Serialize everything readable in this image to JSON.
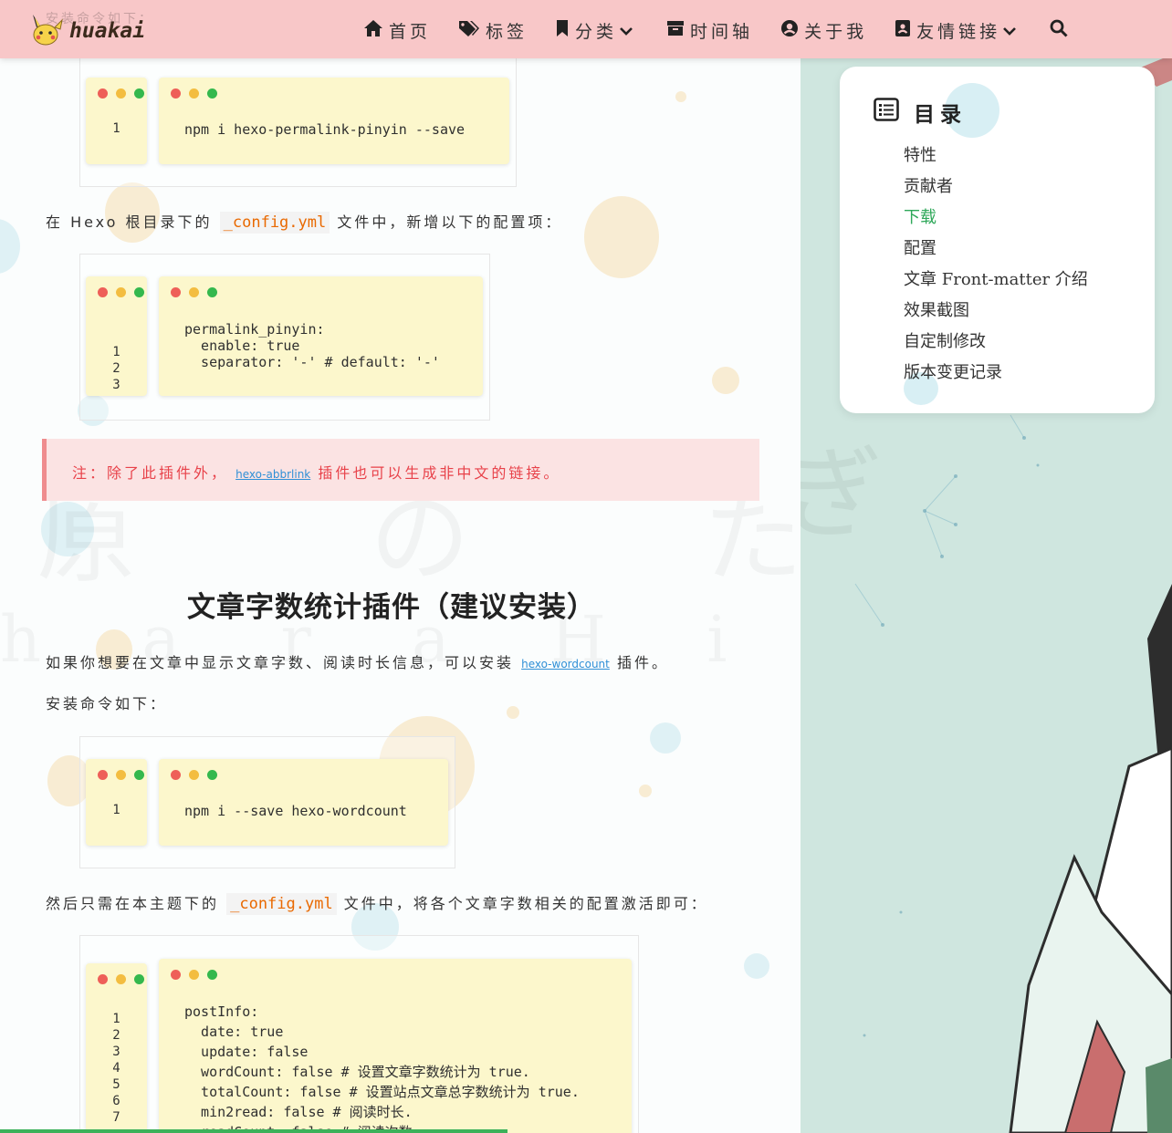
{
  "navbar": {
    "brand": "huakai",
    "ghost_text": "安装命令如下：",
    "items": [
      {
        "label": "首页",
        "icon": "home-icon"
      },
      {
        "label": "标签",
        "icon": "tags-icon"
      },
      {
        "label": "分类",
        "icon": "bookmark-icon",
        "dropdown": true
      },
      {
        "label": "时间轴",
        "icon": "archive-icon"
      },
      {
        "label": "关于我",
        "icon": "user-circle-icon"
      },
      {
        "label": "友情链接",
        "icon": "address-book-icon",
        "dropdown": true
      }
    ],
    "search_icon": "search-icon"
  },
  "blocks": {
    "code1": {
      "lines": "1",
      "code": "npm i hexo-permalink-pinyin --save"
    },
    "para1": {
      "before": "在 Hexo 根目录下的",
      "code": "_config.yml",
      "after": "文件中，新增以下的配置项："
    },
    "code2": {
      "lines": "1\n2\n3",
      "code": "permalink_pinyin:\n  enable: true\n  separator: '-' # default: '-'"
    },
    "note": {
      "prefix": "注：除了此插件外，",
      "link": "hexo-abbrlink",
      "suffix": "插件也可以生成非中文的链接。"
    },
    "heading": "文章字数统计插件（建议安装）",
    "para2": {
      "before": "如果你想要在文章中显示文章字数、阅读时长信息，可以安装",
      "link": "hexo-wordcount",
      "after": "插件。"
    },
    "para3": "安装命令如下：",
    "code3": {
      "lines": "1",
      "code": "npm i --save hexo-wordcount"
    },
    "para4": {
      "before": "然后只需在本主题下的",
      "code": "_config.yml",
      "after": "文件中，将各个文章字数相关的配置激活即可："
    },
    "code4": {
      "lines": "1\n2\n3\n4\n5\n6\n7",
      "code": "postInfo:\n  date: true\n  update: false\n  wordCount: false # 设置文章字数统计为 true.\n  totalCount: false # 设置站点文章总字数统计为 true.\n  min2read: false # 阅读时长.\n  readCount: false # 阅读次数."
    }
  },
  "watermark": {
    "line1": "原 の た ぎ",
    "line2": "h a r a   H i t a g i"
  },
  "toc": {
    "title": "目录",
    "items": [
      {
        "label": "特性",
        "active": false
      },
      {
        "label": "贡献者",
        "active": false
      },
      {
        "label": "下载",
        "active": true
      },
      {
        "label": "配置",
        "active": false
      },
      {
        "label": "文章 Front-matter 介绍",
        "active": false
      },
      {
        "label": "效果截图",
        "active": false
      },
      {
        "label": "自定制修改",
        "active": false
      },
      {
        "label": "版本变更记录",
        "active": false
      }
    ]
  },
  "colors": {
    "navbar": "#f8c7c8",
    "toc_active": "#2fa85a",
    "progress": "#3bb15a",
    "note_text": "#e8424a"
  }
}
